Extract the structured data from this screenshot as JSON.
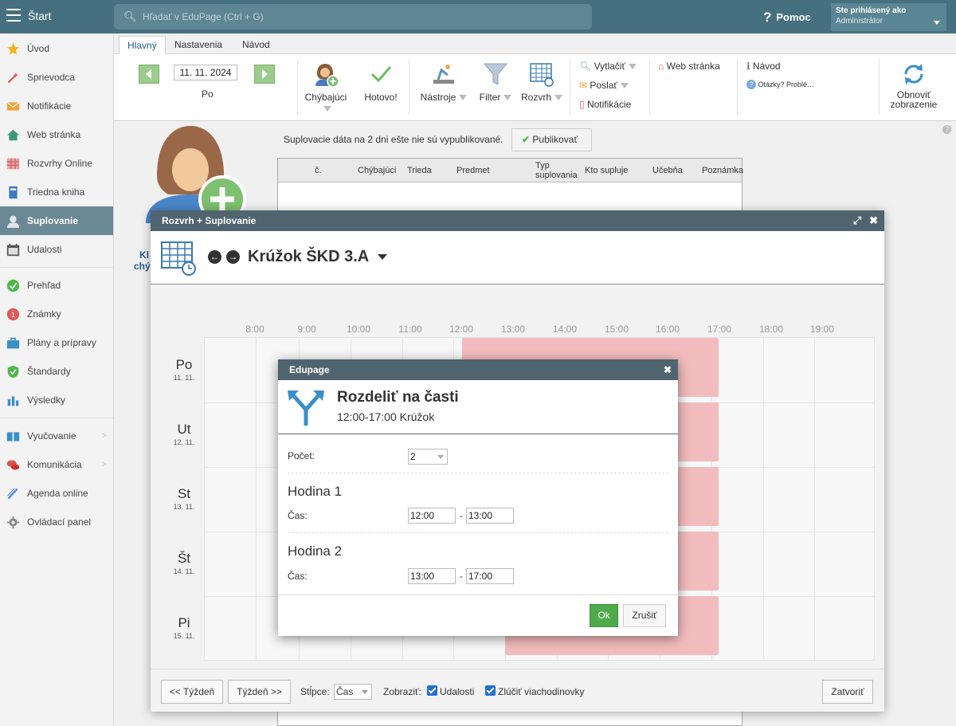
{
  "topbar": {
    "title": "Štart",
    "search_placeholder": "Hľadať v EduPage (Ctrl + G)",
    "help": "Pomoc",
    "user_line1": "Ste prihlásený ako",
    "user_line2": "Administrátor"
  },
  "sidebar": {
    "items": [
      {
        "label": "Úvod",
        "icon": "star-icon"
      },
      {
        "label": "Sprievodca",
        "icon": "wand-icon"
      },
      {
        "label": "Notifikácie",
        "icon": "envelope-icon"
      },
      {
        "label": "Web stránka",
        "icon": "house-icon"
      },
      {
        "label": "Rozvrhy Online",
        "icon": "timetable-icon"
      },
      {
        "label": "Triedna kniha",
        "icon": "book-icon"
      },
      {
        "label": "Suplovanie",
        "icon": "person-icon"
      },
      {
        "label": "Udalosti",
        "icon": "calendar-icon"
      },
      {
        "label": "Prehľad",
        "icon": "check-circle-icon"
      },
      {
        "label": "Známky",
        "icon": "grade-icon"
      },
      {
        "label": "Plány a prípravy",
        "icon": "briefcase-icon"
      },
      {
        "label": "Štandardy",
        "icon": "shield-icon"
      },
      {
        "label": "Výsledky",
        "icon": "bar-chart-icon"
      },
      {
        "label": "Vyučovanie",
        "icon": "open-book-icon"
      },
      {
        "label": "Komunikácia",
        "icon": "chat-icon"
      },
      {
        "label": "Agenda online",
        "icon": "pen-icon"
      },
      {
        "label": "Ovládací panel",
        "icon": "gear-icon"
      }
    ],
    "active": "Suplovanie"
  },
  "tabs": [
    "Hlavný",
    "Nastavenia",
    "Návod"
  ],
  "ribbon": {
    "date": "11. 11. 2024",
    "day": "Po",
    "missing": "Chýbajúci",
    "done": "Hotovo!",
    "tools": "Nástroje",
    "filter": "Filter",
    "timetable": "Rozvrh",
    "print": "Vytlačiť",
    "send": "Poslať",
    "notifications": "Notifikácie",
    "website": "Web stránka",
    "guide": "Návod",
    "questions": "Otázky? Problé…",
    "refresh_l1": "Obnoviť",
    "refresh_l2": "zobrazenie"
  },
  "content": {
    "notice": "Suplovacie dáta na 2 dni ešte nie sú vypublikované.",
    "publish": "Publikovať",
    "columns": [
      "č.",
      "Chýbajúci",
      "Trieda",
      "Predmet",
      "Typ suplovania",
      "Kto supluje",
      "Učebňa",
      "Poznámka"
    ],
    "behind_l1": "Kl",
    "behind_l2": "chý"
  },
  "window": {
    "title": "Rozvrh + Suplovanie",
    "class_name": "Krúžok ŠKD 3.A",
    "hours": [
      "8:00",
      "9:00",
      "10:00",
      "11:00",
      "12:00",
      "13:00",
      "14:00",
      "15:00",
      "16:00",
      "17:00",
      "18:00",
      "19:00"
    ],
    "days": [
      {
        "name": "Po",
        "date": "11. 11."
      },
      {
        "name": "Ut",
        "date": "12. 11."
      },
      {
        "name": "St",
        "date": "13. 11."
      },
      {
        "name": "Št",
        "date": "14. 11."
      },
      {
        "name": "Pi",
        "date": "15. 11."
      }
    ],
    "event_color": "#f2bcbe",
    "footer": {
      "prev_week": "<< Týždeň",
      "next_week": "Týždeň >>",
      "columns_label": "Stĺpce:",
      "columns_value": "Čas",
      "show_label": "Zobraziť:",
      "events": "Udalosti",
      "merge": "Zlúčiť viachodinovky",
      "close": "Zatvoriť"
    }
  },
  "dialog": {
    "title": "Edupage",
    "heading": "Rozdeliť na časti",
    "subtitle": "12:00-17:00 Krúžok",
    "count_label": "Počet:",
    "count_value": "2",
    "part1": "Hodina 1",
    "part1_time_label": "Čas:",
    "part1_from": "12:00",
    "part1_to": "13:00",
    "part2": "Hodina 2",
    "part2_time_label": "Čas:",
    "part2_from": "13:00",
    "part2_to": "17:00",
    "dash": "-",
    "ok": "Ok",
    "cancel": "Zrušiť"
  }
}
